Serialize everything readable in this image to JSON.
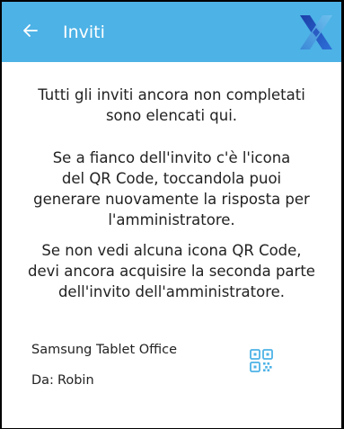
{
  "appbar": {
    "title": "Inviti",
    "back_icon": "arrow-left-icon",
    "logo_icon": "x-logo-icon",
    "background": "#4db2e6"
  },
  "messages": [
    "Tutti gli inviti ancora non completati\nsono elencati qui.",
    "Se a fianco dell'invito c'è l'icona\ndel QR Code, toccandola puoi\ngenerare nuovamente la risposta per\nl'amministratore.",
    "Se non vedi alcuna icona QR Code,\ndevi ancora acquisire la seconda parte\ndell'invito dell'amministratore."
  ],
  "invites": [
    {
      "device": "Samsung Tablet Office",
      "from_prefix": "Da:",
      "from_name": "Robin",
      "action_icon": "qr-code-icon",
      "accent": "#4db2e6"
    }
  ]
}
